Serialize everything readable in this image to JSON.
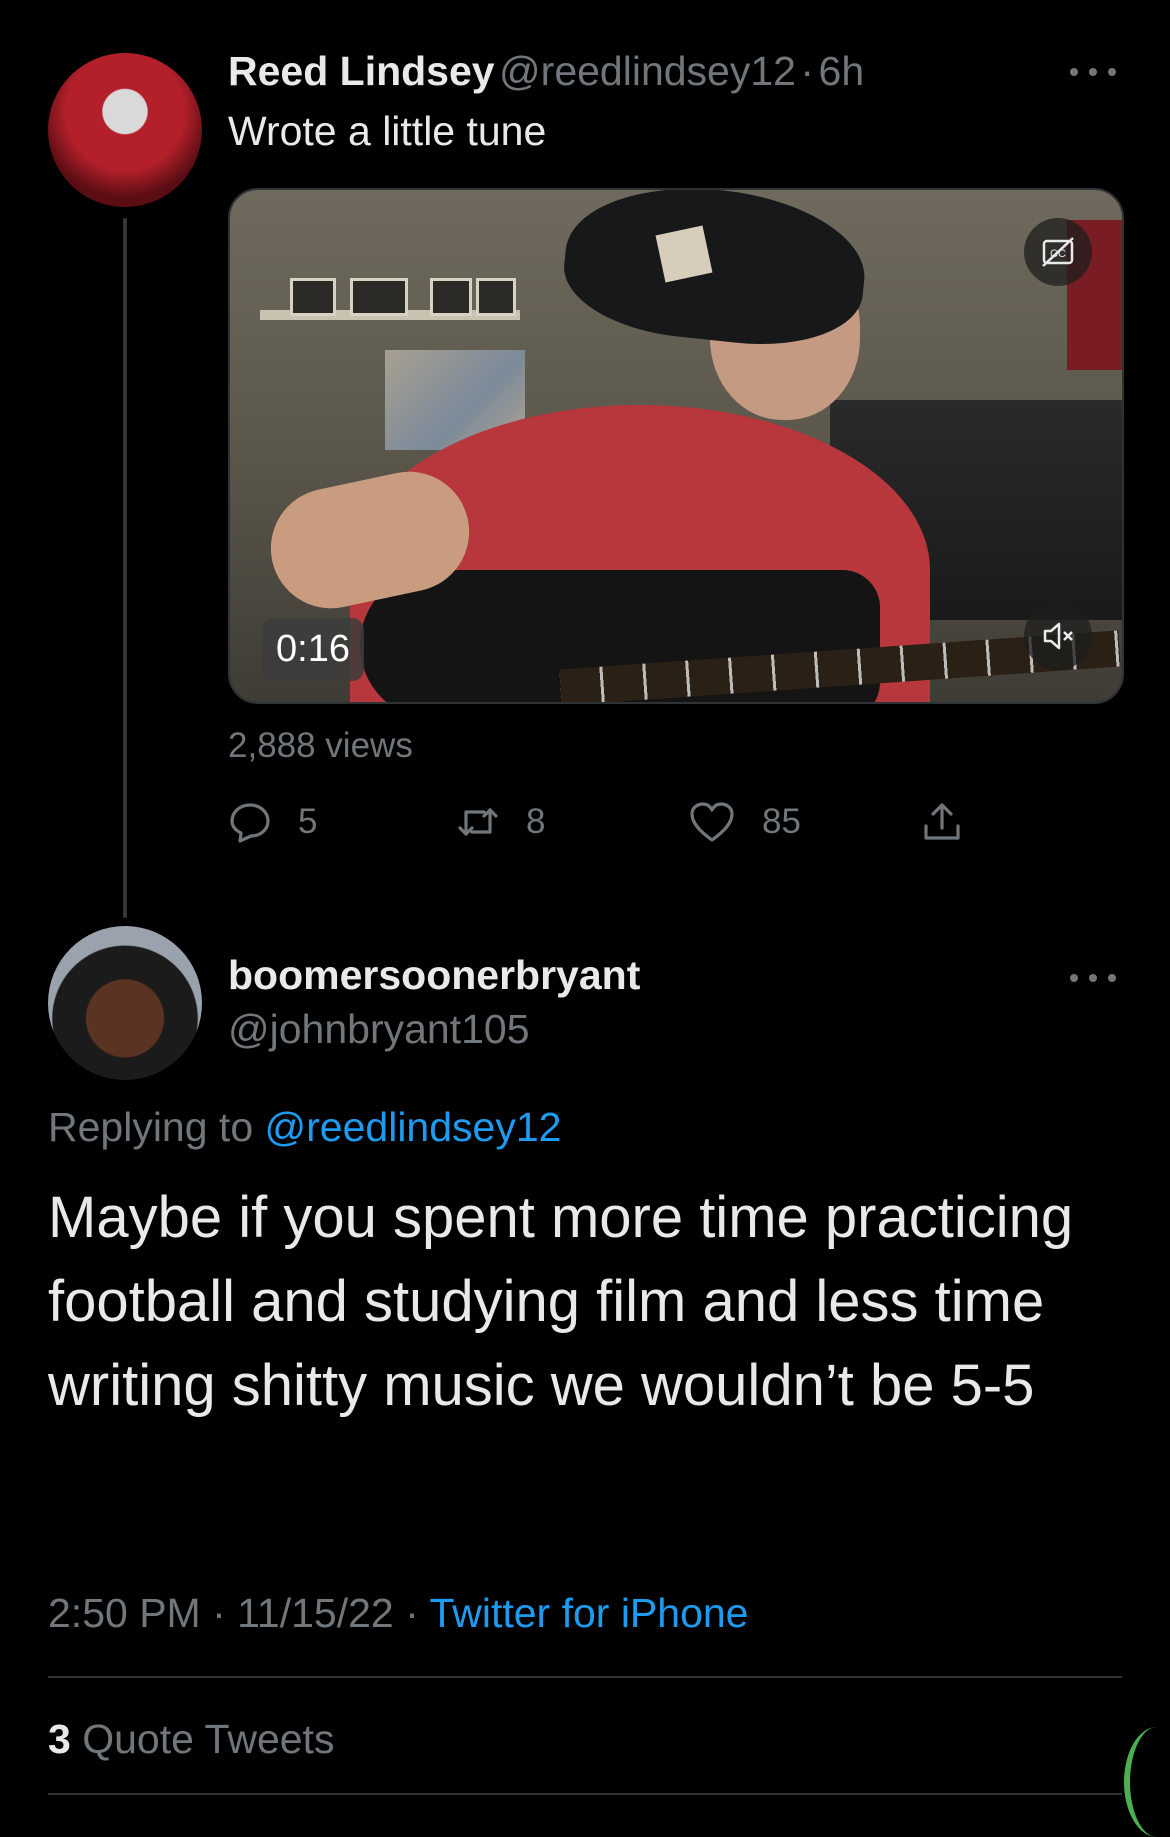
{
  "tweet": {
    "author_name": "Reed Lindsey",
    "author_handle": "@reedlindsey12",
    "separator": "·",
    "age": "6h",
    "text": "Wrote a little tune",
    "video": {
      "duration": "0:16",
      "cc_icon": "captions-off-icon",
      "mute_icon": "speaker-muted-icon"
    },
    "views": "2,888 views",
    "stats": {
      "replies": "5",
      "retweets": "8",
      "likes": "85"
    }
  },
  "reply": {
    "author_name": "boomersoonerbryant",
    "author_handle": "@johnbryant105",
    "replying_prefix": "Replying to",
    "replying_to": "@reedlindsey12",
    "text": "Maybe if you spent more time practicing football and studying film and less time writing shitty music we wouldn’t be 5-5",
    "time": "2:50 PM",
    "date": "11/15/22",
    "separator": "·",
    "source": "Twitter for iPhone",
    "quote_count": "3",
    "quote_label": "Quote Tweets"
  },
  "colors": {
    "background": "#000000",
    "text": "#e7e9ea",
    "secondary": "#71767b",
    "link": "#1d9bf0"
  }
}
